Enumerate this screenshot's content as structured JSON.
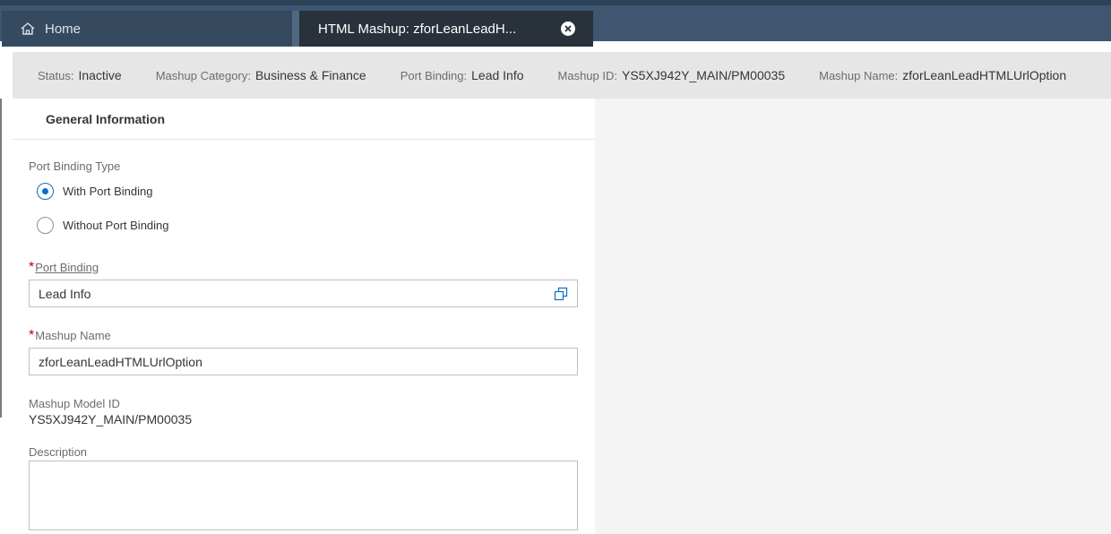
{
  "tabs": {
    "home_label": "Home",
    "active_label": "HTML Mashup: zforLeanLeadH..."
  },
  "header_info": [
    {
      "label": "Status:",
      "value": "Inactive"
    },
    {
      "label": "Mashup Category:",
      "value": "Business & Finance"
    },
    {
      "label": "Port Binding:",
      "value": "Lead Info"
    },
    {
      "label": "Mashup ID:",
      "value": "YS5XJ942Y_MAIN/PM00035"
    },
    {
      "label": "Mashup Name:",
      "value": "zforLeanLeadHTMLUrlOption"
    }
  ],
  "section": {
    "title": "General Information"
  },
  "port_binding_type": {
    "label": "Port Binding Type",
    "options": [
      "With Port Binding",
      "Without Port Binding"
    ],
    "selected": "With Port Binding"
  },
  "port_binding": {
    "required": "*",
    "label": "Port Binding",
    "value": "Lead Info"
  },
  "mashup_name": {
    "required": "*",
    "label": "Mashup Name",
    "value": "zforLeanLeadHTMLUrlOption"
  },
  "mashup_model_id": {
    "label": "Mashup Model ID",
    "value": "YS5XJ942Y_MAIN/PM00035"
  },
  "description": {
    "label": "Description",
    "value": ""
  },
  "icons": {
    "home": "home-icon",
    "close": "close-icon",
    "value_help": "value-help-icon"
  },
  "colors": {
    "shell": "#3e566f",
    "active_tab": "#29313a",
    "accent": "#0a6ed1",
    "required": "#bb0000",
    "info_bar": "#e6e6e6"
  }
}
